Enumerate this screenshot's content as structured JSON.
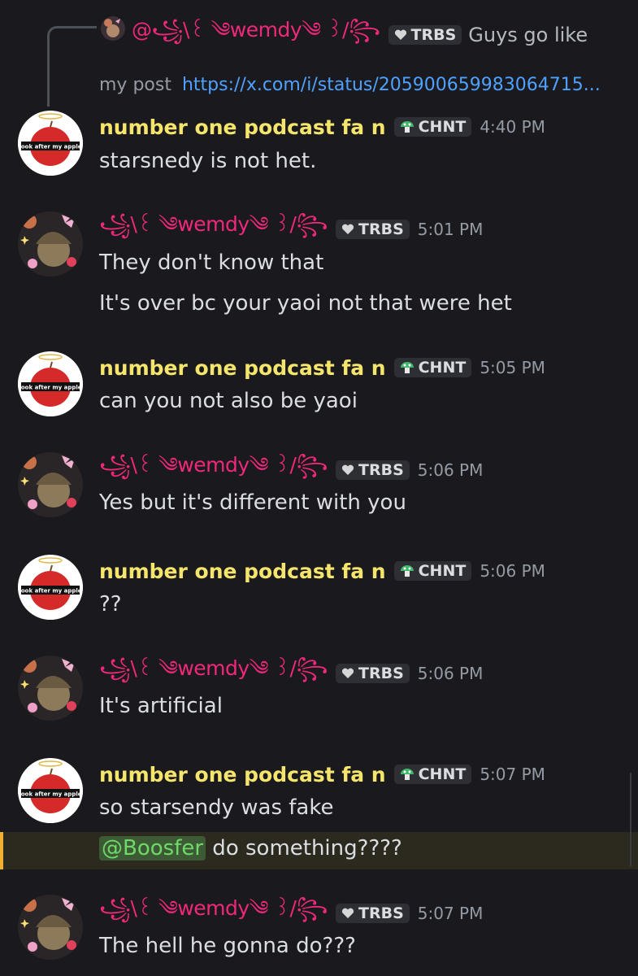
{
  "reply": {
    "author": "@꧁\\꒰ ༄wemdy༄ ꒱/꧂",
    "tag": "TRBS",
    "text": "Guys go like",
    "context": "my post",
    "link": "https://x.com/i/status/205900659983064715..."
  },
  "avatars": {
    "apple_label": "look after my apple"
  },
  "messages": [
    {
      "author": "number one podcast fa n",
      "kind": "apple",
      "tag": "CHNT",
      "time": "4:40 PM",
      "lines": [
        "starsnedy is not het."
      ]
    },
    {
      "author": "꧁\\꒰ ༄wemdy༄ ꒱/꧂",
      "kind": "wemdy",
      "tag": "TRBS",
      "time": "5:01 PM",
      "lines": [
        "They don't know that",
        "It's over bc your yaoi not that were het"
      ]
    },
    {
      "author": "number one podcast fa n",
      "kind": "apple",
      "tag": "CHNT",
      "time": "5:05 PM",
      "lines": [
        "can you not also be yaoi"
      ]
    },
    {
      "author": "꧁\\꒰ ༄wemdy༄ ꒱/꧂",
      "kind": "wemdy",
      "tag": "TRBS",
      "time": "5:06 PM",
      "lines": [
        "Yes but it's different with you"
      ]
    },
    {
      "author": "number one podcast fa n",
      "kind": "apple",
      "tag": "CHNT",
      "time": "5:06 PM",
      "lines": [
        "??"
      ]
    },
    {
      "author": "꧁\\꒰ ༄wemdy༄ ꒱/꧂",
      "kind": "wemdy",
      "tag": "TRBS",
      "time": "5:06 PM",
      "lines": [
        "It's artificial"
      ]
    },
    {
      "author": "number one podcast fa n",
      "kind": "apple",
      "tag": "CHNT",
      "time": "5:07 PM",
      "lines": [
        "so starsendy was fake"
      ],
      "mention": {
        "user": "@Boosfer",
        "text": " do something????"
      }
    },
    {
      "author": "꧁\\꒰ ༄wemdy༄ ꒱/꧂",
      "kind": "wemdy",
      "tag": "TRBS",
      "time": "5:07 PM",
      "lines": [
        "The hell he gonna do???"
      ]
    }
  ],
  "colors": {
    "background": "#1a1a1e",
    "apple_name": "#f5e56c",
    "wemdy_name": "#f0287a",
    "link": "#4ea1ff",
    "mention_highlight": "#f0b132"
  },
  "icons": {
    "chnt_tag": "mushroom-icon",
    "trbs_tag": "heart-icon"
  }
}
